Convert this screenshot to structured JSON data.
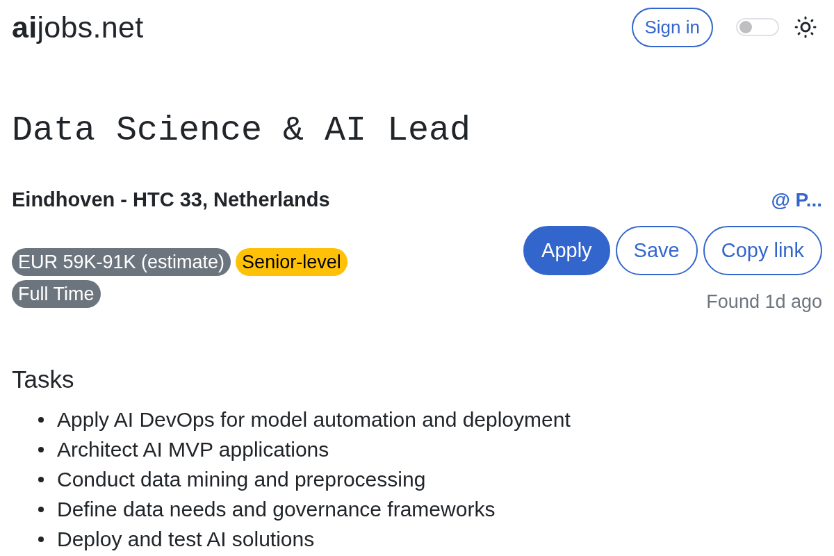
{
  "header": {
    "logo": "**ai**jobs.net",
    "sign_in": "Sign in",
    "theme_switch": {
      "on": false
    }
  },
  "job": {
    "title": "Data Science & AI Lead",
    "location": "Eindhoven - HTC 33, Netherlands",
    "company_link": "@ P...",
    "badges": [
      {
        "label": "EUR 59K-91K (estimate)",
        "color": "#6c757d"
      },
      {
        "label": "Senior-level",
        "color": "#ffc107"
      },
      {
        "label": "Full Time",
        "color": "#6c757d"
      }
    ],
    "actions": [
      {
        "label": "Apply",
        "kind": "primary"
      },
      {
        "label": "Save",
        "kind": "outline"
      },
      {
        "label": "Copy link",
        "kind": "outline"
      }
    ],
    "posted": "Found 1d ago"
  },
  "sections": [
    {
      "heading": "Tasks",
      "items": [
        "Apply AI DevOps for model automation and deployment",
        "Architect AI MVP applications",
        "Conduct data mining and preprocessing",
        "Define data needs and governance frameworks",
        "Deploy and test AI solutions"
      ]
    }
  ]
}
